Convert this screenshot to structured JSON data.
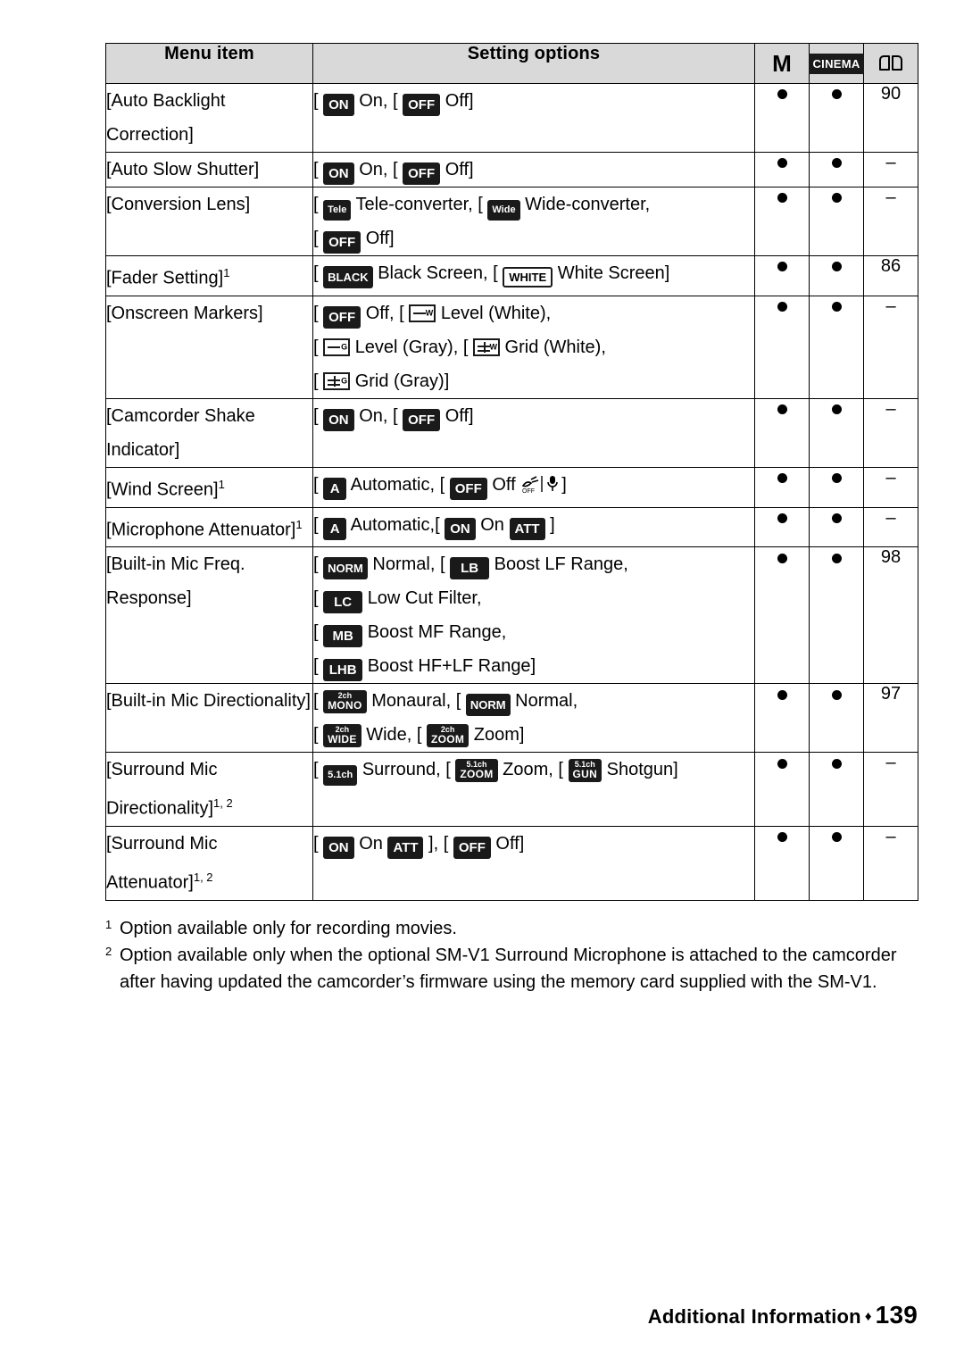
{
  "table": {
    "headers": {
      "menu_item": "Menu item",
      "setting_options": "Setting options",
      "mode_m": "M",
      "mode_cinema": "CINEMA",
      "page_col": "book-icon"
    },
    "rows": [
      {
        "item": "[Auto Backlight Correction]",
        "options_text": "[ ON On], [ OFF Off]",
        "m": "●",
        "cinema": "●",
        "page": "90"
      },
      {
        "item": "[Auto Slow Shutter]",
        "options_text": "[ ON On], [ OFF Off]",
        "m": "●",
        "cinema": "●",
        "page": "–"
      },
      {
        "item": "[Conversion Lens]",
        "options_text": "[ Tele Tele-converter], [ Wide Wide-converter], [ OFF Off]",
        "m": "●",
        "cinema": "●",
        "page": "–"
      },
      {
        "item": "[Fader Setting]",
        "item_footnote": "1",
        "options_text": "[ BLACK Black Screen], [ WHITE White Screen]",
        "m": "●",
        "cinema": "●",
        "page": "86"
      },
      {
        "item": "[Onscreen Markers]",
        "options_text": "[ OFF Off], [ W Level (White)], [ G Level (Gray)], [ W Grid (White)], [ G Grid (Gray)]",
        "m": "●",
        "cinema": "●",
        "page": "–"
      },
      {
        "item": "[Camcorder Shake Indicator]",
        "options_text": "[ ON On], [ OFF Off]",
        "m": "●",
        "cinema": "●",
        "page": "–"
      },
      {
        "item": "[Wind Screen]",
        "item_footnote": "1",
        "options_text": "[ A Automatic], [ OFF Off ✂/♀]",
        "m": "●",
        "cinema": "●",
        "page": "–"
      },
      {
        "item": "[Microphone Attenuator]",
        "item_footnote": "1",
        "options_text": "[ A Automatic],[ ON On ATT ]",
        "m": "●",
        "cinema": "●",
        "page": "–"
      },
      {
        "item": "[Built-in Mic Freq. Response]",
        "options_text": "[ NORM Normal], [ LB Boost LF Range], [ LC Low Cut Filter], [ MB Boost MF Range], [ LHB Boost HF+LF Range]",
        "m": "●",
        "cinema": "●",
        "page": "98"
      },
      {
        "item": "[Built-in Mic Directionality]",
        "options_text": "[ 2ch MONO Monaural], [ NORM Normal], [ 2ch WIDE Wide], [ 2ch ZOOM Zoom]",
        "m": "●",
        "cinema": "●",
        "page": "97"
      },
      {
        "item": "[Surround Mic Directionality]",
        "item_footnote": "1, 2",
        "options_text": "[ 5.1ch Surround], [ 5.1ch ZOOM Zoom], [ 5.1ch GUN Shotgun]",
        "m": "●",
        "cinema": "●",
        "page": "–"
      },
      {
        "item": "[Surround Mic Attenuator]",
        "item_footnote": "1, 2",
        "options_text": "[ ON On ATT ], [ OFF Off]",
        "m": "●",
        "cinema": "●",
        "page": "–"
      }
    ]
  },
  "labels": {
    "on": "On",
    "off": "Off",
    "tele_converter": "Tele-converter,",
    "wide_converter": "Wide-converter,",
    "black_screen": "Black Screen,",
    "white_screen": "White Screen",
    "off_comma": "Off,",
    "level_white": "Level (White),",
    "level_gray": "Level (Gray),",
    "grid_white": "Grid (White),",
    "grid_gray": "Grid (Gray)",
    "automatic_comma": "Automatic,",
    "automatic_comma2": "Automatic,",
    "on_plain": "On",
    "normal_comma": "Normal,",
    "boost_lf": "Boost LF Range,",
    "low_cut": "Low Cut Filter,",
    "boost_mf": "Boost MF Range,",
    "boost_hflf": "Boost HF+LF Range",
    "monaural_comma": "Monaural,",
    "normal2": "Normal,",
    "wide_comma": "Wide,",
    "zoom": "Zoom",
    "surround_comma": "Surround,",
    "zoom_comma": "Zoom,",
    "shotgun": "Shotgun",
    "on_att": "On",
    "off2": "Off",
    "off_mic": "Off"
  },
  "chips": {
    "on": "ON",
    "off": "OFF",
    "tele": "Tele",
    "wide": "Wide",
    "black": "BLACK",
    "white": "WHITE",
    "a": "A",
    "att": "ATT",
    "norm": "NORM",
    "lb": "LB",
    "lc": "LC",
    "mb": "MB",
    "lhb": "LHB",
    "mono_l1": "2ch",
    "mono_l2": "MONO",
    "wide_l1": "2ch",
    "wide_l2": "WIDE",
    "zoom_l1": "2ch",
    "zoom_l2": "ZOOM",
    "sur_l1": "5.1ch",
    "sur_zoom_l1": "5.1ch",
    "sur_zoom_l2": "ZOOM",
    "sur_gun_l1": "5.1ch",
    "sur_gun_l2": "GUN",
    "mark_w": "W",
    "mark_g": "G"
  },
  "footnotes": [
    {
      "num": "1",
      "text": "Option available only for recording movies."
    },
    {
      "num": "2",
      "text": "Option available only when the optional SM-V1 Surround Microphone is attached to the camcorder after having updated the camcorder’s firmware using the memory card supplied with the SM-V1."
    }
  ],
  "footer": {
    "section": "Additional Information",
    "separator": "♦",
    "page_number": "139"
  }
}
